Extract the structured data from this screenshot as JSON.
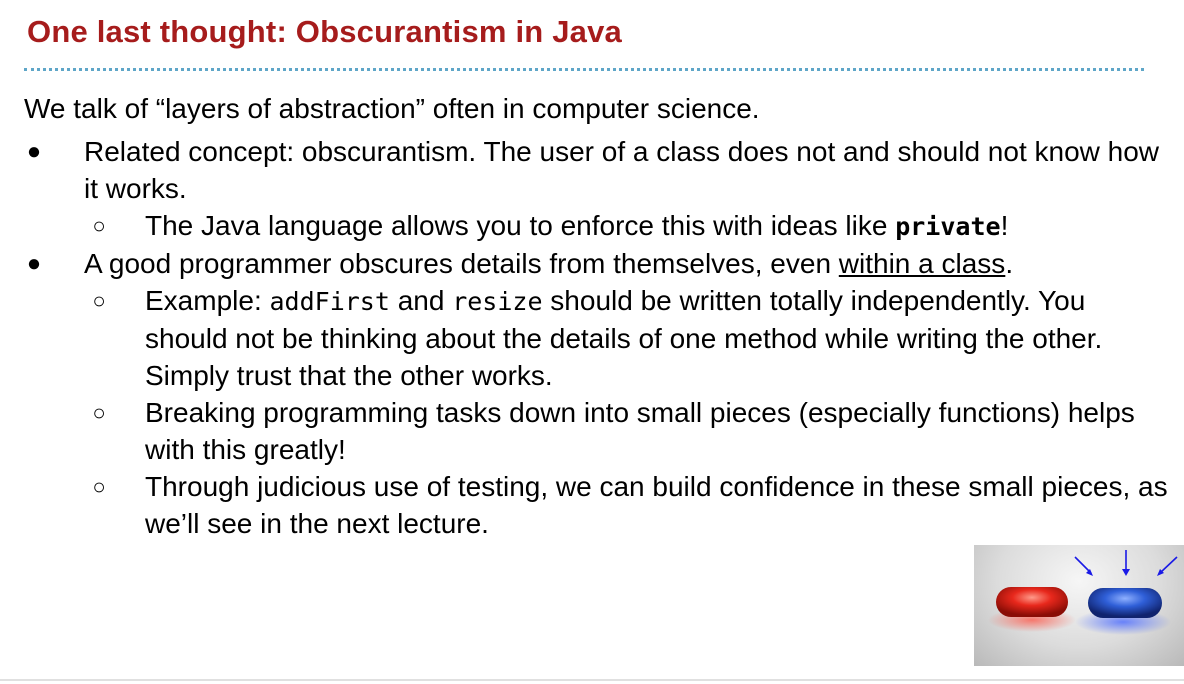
{
  "slide": {
    "title": "One last thought: Obscurantism in Java",
    "intro": "We talk of “layers of abstraction” often in computer science.",
    "bullet1": "Related concept: obscurantism. The user of a class does not and should not know how it works.",
    "sub1_text": "The Java language allows you to enforce this with ideas like ",
    "sub1_code": "private",
    "sub1_end": "!",
    "bullet2_text": "A good programmer obscures details from themselves, even ",
    "bullet2_link": "within a class",
    "bullet2_end": ".",
    "sub2_a": "Example: ",
    "sub2_code1": "addFirst",
    "sub2_b": " and ",
    "sub2_code2": "resize",
    "sub2_c": " should be written totally independently. You should not be thinking about the details of one method while writing the other. Simply trust that the other works.",
    "sub3": "Breaking programming tasks down into small pieces (especially functions) helps with this greatly!",
    "sub4": "Through judicious use of testing, we can build confidence in these small pieces, as we’ll see in the next lecture.",
    "bullet_symbol": "●",
    "sub_bullet_symbol": "○"
  },
  "image": {
    "description_icon": "red-and-blue-pills-image",
    "red_color": "#e8281c",
    "blue_color": "#2f5fd8",
    "arrow_color": "#1a1ae6"
  }
}
